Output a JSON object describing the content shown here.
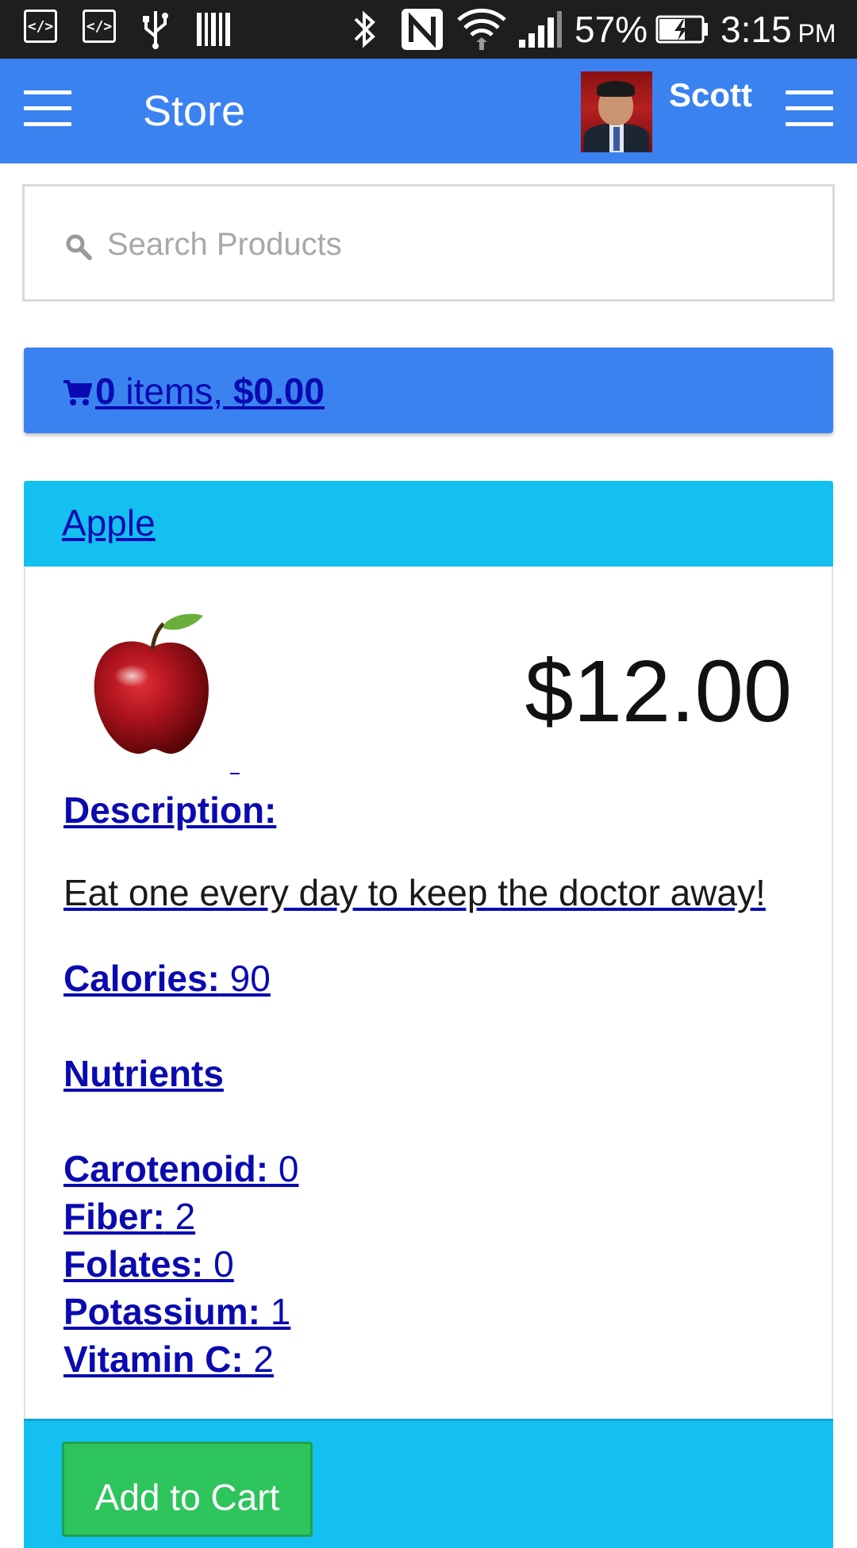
{
  "status_bar": {
    "battery": "57%",
    "time": "3:15",
    "ampm": "PM"
  },
  "app_bar": {
    "title": "Store",
    "user_name": "Scott"
  },
  "search": {
    "placeholder": "Search Products"
  },
  "cart": {
    "count": "0",
    "items_label": " items, ",
    "total": "$0.00"
  },
  "product": {
    "name": "Apple",
    "price": "$12.00",
    "description_label": "Description:",
    "description": "Eat one every day to keep the doctor away!",
    "calories_label": "Calories:",
    "calories": "90",
    "nutrients_heading": "Nutrients",
    "nutrients": [
      {
        "label": "Carotenoid:",
        "value": "0"
      },
      {
        "label": "Fiber:",
        "value": "2"
      },
      {
        "label": "Folates:",
        "value": "0"
      },
      {
        "label": "Potassium:",
        "value": "1"
      },
      {
        "label": "Vitamin C:",
        "value": "2"
      }
    ],
    "add_to_cart_label": "Add to Cart"
  },
  "colors": {
    "app_bar": "#3b82f1",
    "panel_header": "#13c0f0",
    "add_button": "#2ec45c",
    "link": "#0a0ab0"
  }
}
